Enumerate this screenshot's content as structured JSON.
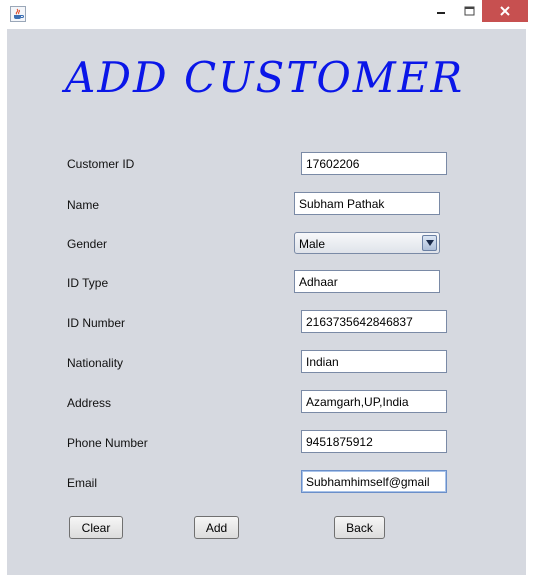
{
  "window": {
    "icons": {
      "app": "java-cup-icon",
      "minimize": "minimize-icon",
      "maximize": "maximize-icon",
      "close": "close-icon"
    },
    "close_color": "#c75050"
  },
  "form": {
    "heading": "ADD CUSTOMER",
    "heading_color": "#0a16e8",
    "panel_color": "#d6d9e0",
    "fields": {
      "customer_id": {
        "label": "Customer ID",
        "value": "17602206"
      },
      "name": {
        "label": "Name",
        "value": "Subham Pathak"
      },
      "gender": {
        "label": "Gender",
        "value": "Male"
      },
      "id_type": {
        "label": "ID Type",
        "value": "Adhaar"
      },
      "id_number": {
        "label": "ID Number",
        "value": "2163735642846837"
      },
      "nationality": {
        "label": "Nationality",
        "value": "Indian"
      },
      "address": {
        "label": "Address",
        "value": "Azamgarh,UP,India"
      },
      "phone": {
        "label": "Phone Number",
        "value": "9451875912"
      },
      "email": {
        "label": "Email",
        "value": "Subhamhimself@gmail"
      }
    },
    "buttons": {
      "clear": "Clear",
      "add": "Add",
      "back": "Back"
    }
  }
}
